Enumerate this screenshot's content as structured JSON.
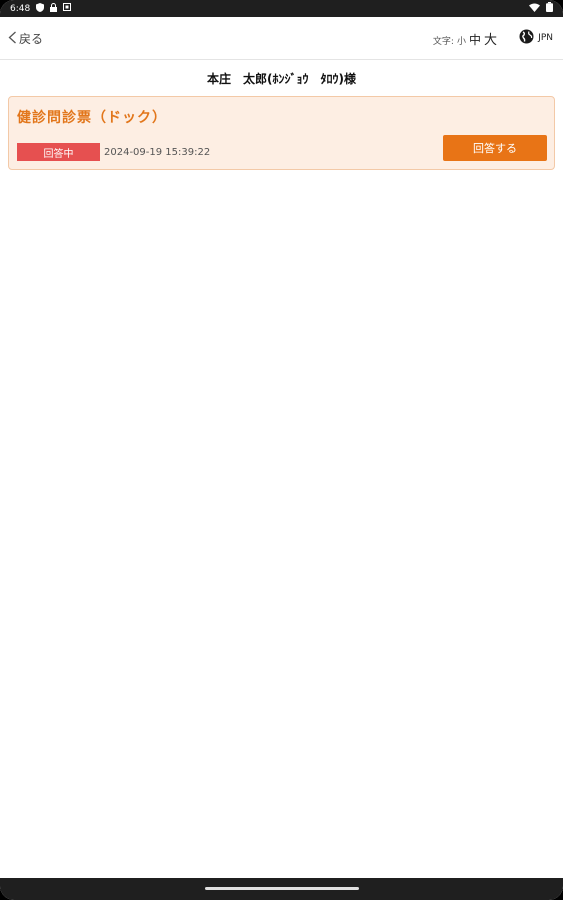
{
  "status_bar": {
    "time": "6:48",
    "icons": [
      "shield-icon",
      "lock-icon",
      "square-icon",
      "wifi-icon",
      "battery-icon"
    ]
  },
  "header": {
    "back_label": "戻る",
    "font_size_label": "文字:",
    "font_small": "小",
    "font_medium": "中",
    "font_large": "大",
    "language": "JPN"
  },
  "patient": {
    "name": "本庄　太郎(ﾎﾝｼﾞｮｳ　ﾀﾛｳ)様"
  },
  "questionnaire": {
    "title": "健診問診票（ドック）",
    "status": "回答中",
    "timestamp": "2024-09-19 15:39:22",
    "answer_label": "回答する"
  },
  "colors": {
    "accent": "#e87416",
    "status_red": "#e65050",
    "card_bg": "#fdeee3"
  }
}
